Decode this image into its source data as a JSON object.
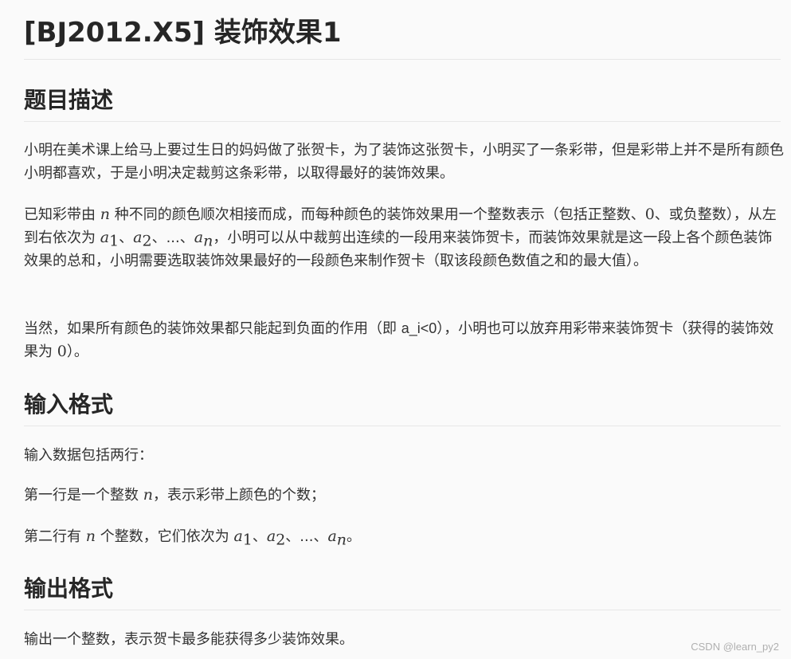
{
  "title": "[BJ2012.X5] 装饰效果1",
  "sections": {
    "description": {
      "heading": "题目描述",
      "p1": "小明在美术课上给马上要过生日的妈妈做了张贺卡，为了装饰这张贺卡，小明买了一条彩带，但是彩带上并不是所有颜色小明都喜欢，于是小明决定裁剪这条彩带，以取得最好的装饰效果。",
      "p2": {
        "t1": "已知彩带由 ",
        "var_n": "n",
        "t2": " 种不同的颜色顺次相接而成，而每种颜色的装饰效果用一个整数表示（包括正整数、",
        "zero": "0",
        "t3": "、或负整数），从左到右依次为 ",
        "a": "a",
        "sub1": "1",
        "sep1": "、",
        "sub2": "2",
        "sep2": "、...、",
        "subn": "n",
        "t4": "，小明可以从中裁剪出连续的一段用来装饰贺卡，而装饰效果就是这一段上各个颜色装饰效果的总和，小明需要选取装饰效果最好的一段颜色来制作贺卡（取该段颜色数值之和的最大值）。"
      },
      "p3": {
        "t1": "当然，如果所有颜色的装饰效果都只能起到负面的作用（即 ",
        "code": "a_i<0",
        "t2": "），小明也可以放弃用彩带来装饰贺卡（获得的装饰效果为 ",
        "zero": "0",
        "t3": "）。"
      }
    },
    "input": {
      "heading": "输入格式",
      "p1": "输入数据包括两行：",
      "p2": {
        "t1": "第一行是一个整数 ",
        "var_n": "n",
        "t2": "，表示彩带上颜色的个数；"
      },
      "p3": {
        "t1": "第二行有 ",
        "var_n": "n",
        "t2": " 个整数，它们依次为 ",
        "a": "a",
        "sub1": "1",
        "sep1": "、",
        "sub2": "2",
        "sep2": "、...、",
        "subn": "n",
        "t3": "。"
      }
    },
    "output": {
      "heading": "输出格式",
      "p1": "输出一个整数，表示贺卡最多能获得多少装饰效果。"
    }
  },
  "watermark": "CSDN @learn_py2"
}
